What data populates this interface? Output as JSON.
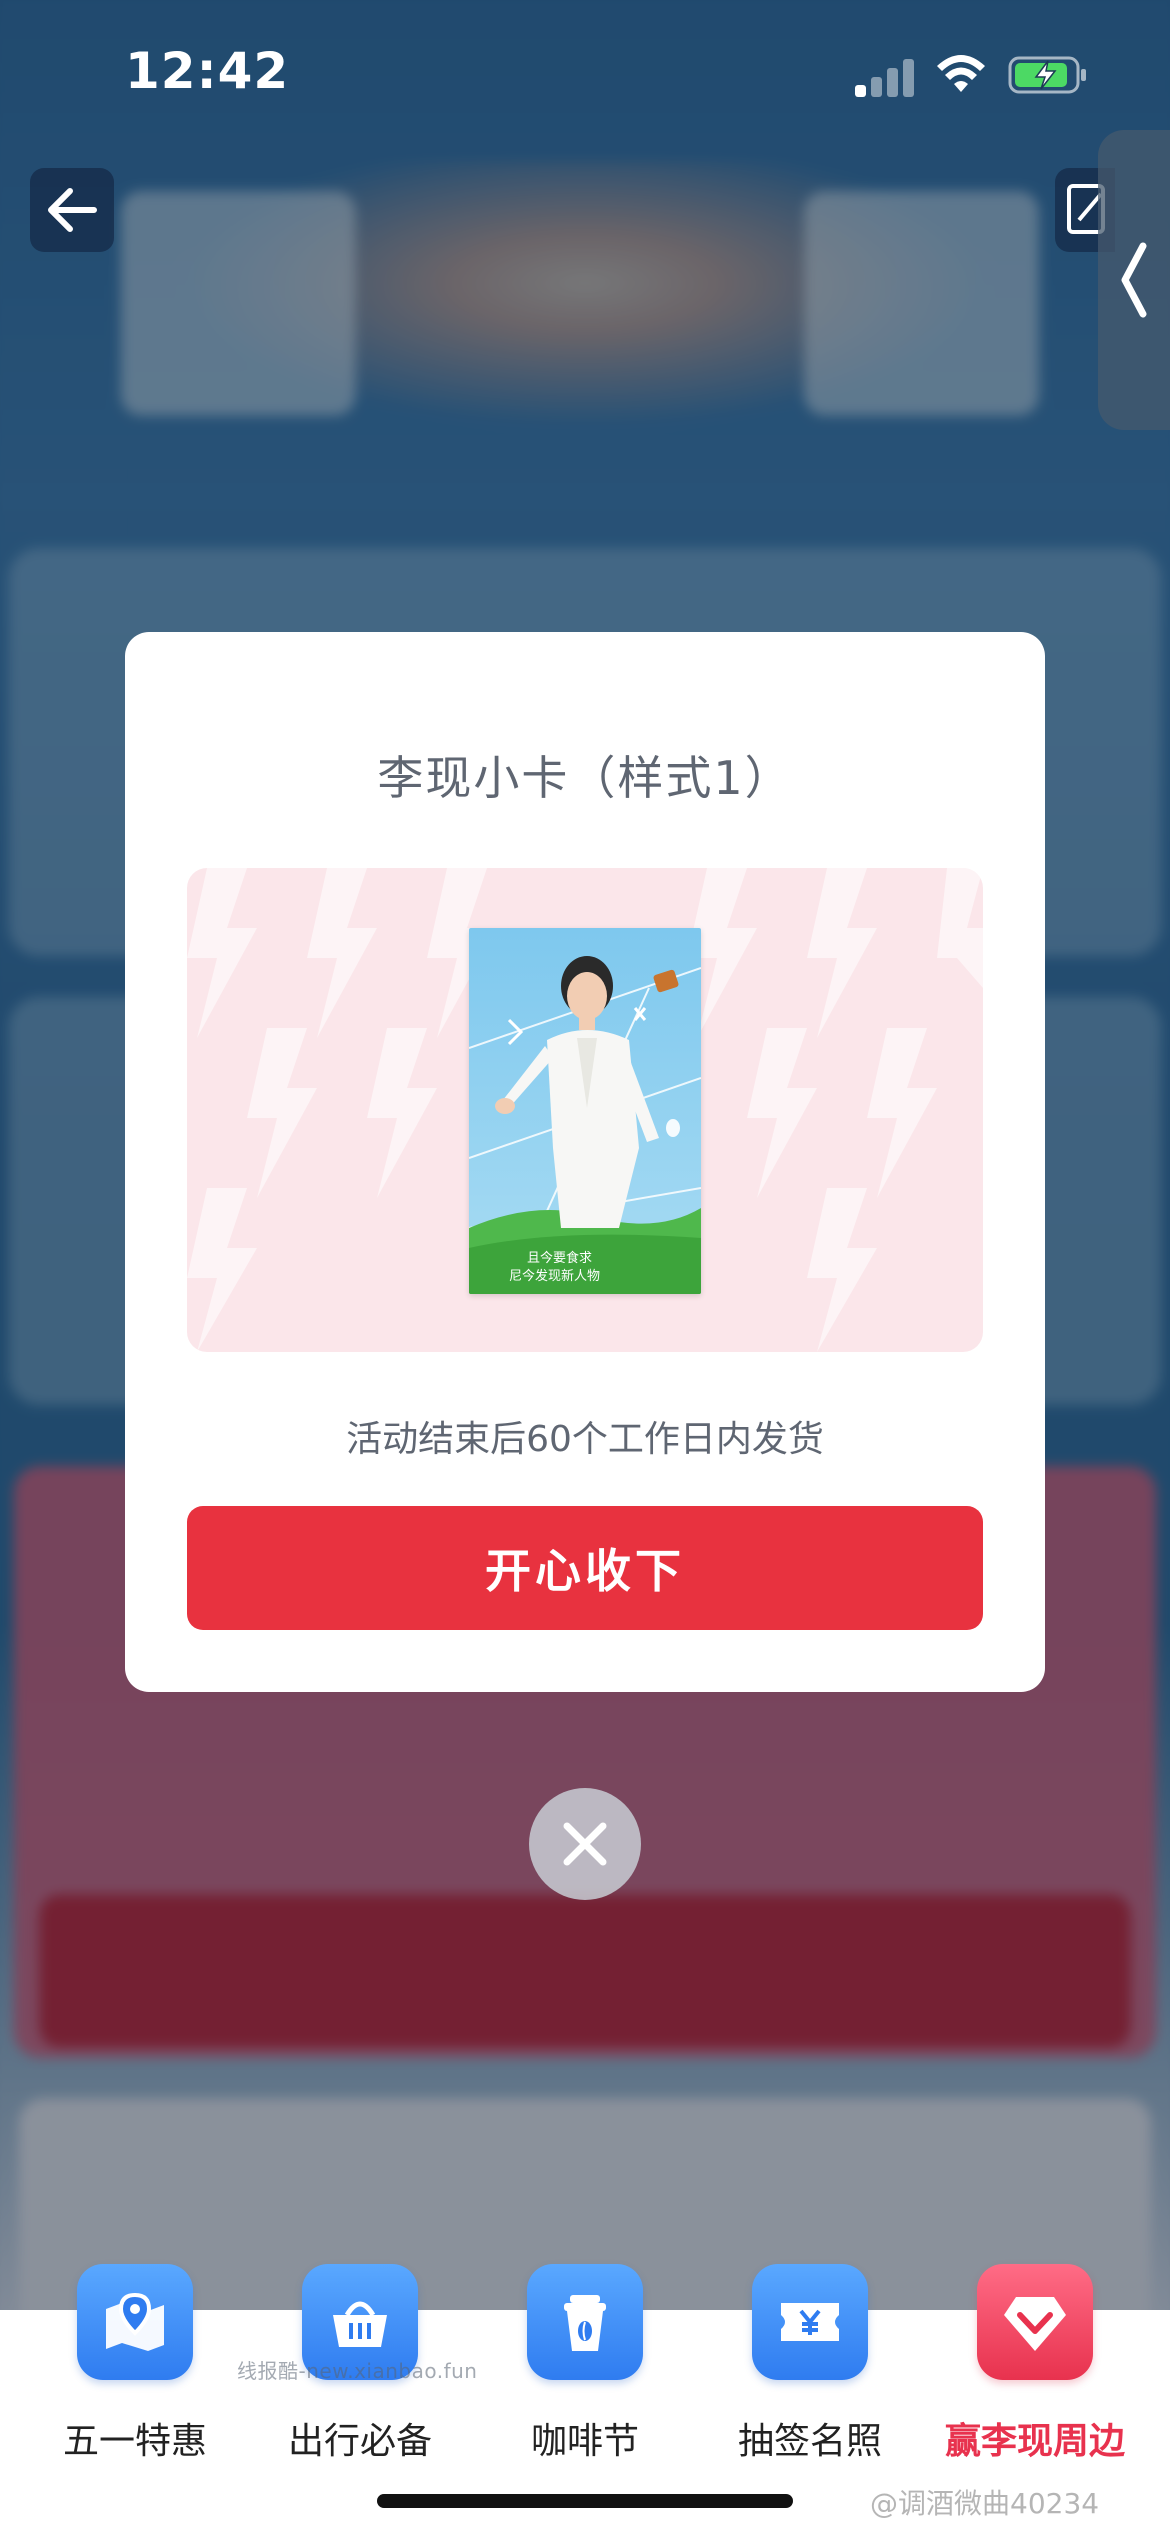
{
  "status_bar": {
    "time": "12:42"
  },
  "modal": {
    "title": "李现小卡（样式1）",
    "ship_note": "活动结束后60个工作日内发货",
    "accept_label": "开心收下",
    "card_caption_line1": "且今要食求",
    "card_caption_line2": "尼今发现新人物"
  },
  "tabs": [
    {
      "label": "五一特惠",
      "icon": "map-pin-icon",
      "active": false
    },
    {
      "label": "出行必备",
      "icon": "basket-icon",
      "active": false
    },
    {
      "label": "咖啡节",
      "icon": "coffee-cup-icon",
      "active": false
    },
    {
      "label": "抽签名照",
      "icon": "ticket-yen-icon",
      "active": false
    },
    {
      "label": "赢李现周边",
      "icon": "heart-gem-icon",
      "active": true
    }
  ],
  "watermarks": {
    "site": "线报酷-new.xianbao.fun",
    "weibo": "@调酒微曲40234"
  },
  "colors": {
    "accent_red": "#e8323f",
    "tab_blue": "#2f7cf0",
    "tab_active": "#e8324e"
  }
}
